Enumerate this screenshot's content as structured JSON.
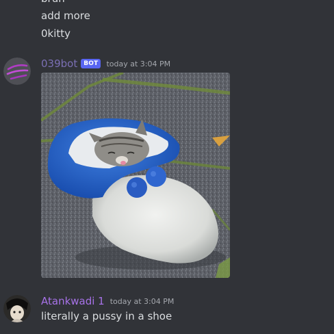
{
  "messages_above": [
    {
      "text": "brun"
    },
    {
      "text": "add more"
    },
    {
      "text": "0kitty"
    }
  ],
  "bot_message": {
    "username": "039bot",
    "badge": "BOT",
    "timestamp": "today at 3:04 PM",
    "username_color": "#7b6fb4",
    "image_subject": "kitten sleeping in a blue and white slipper"
  },
  "user_message": {
    "username": "Atankwadi 1",
    "timestamp": "today at 3:04 PM",
    "text": "literally a pussy in a shoe",
    "username_color": "#a772e8"
  },
  "colors": {
    "background": "#313338",
    "text": "#dbdee1",
    "muted": "#a5a8ae",
    "bot_badge": "#5865f2"
  }
}
